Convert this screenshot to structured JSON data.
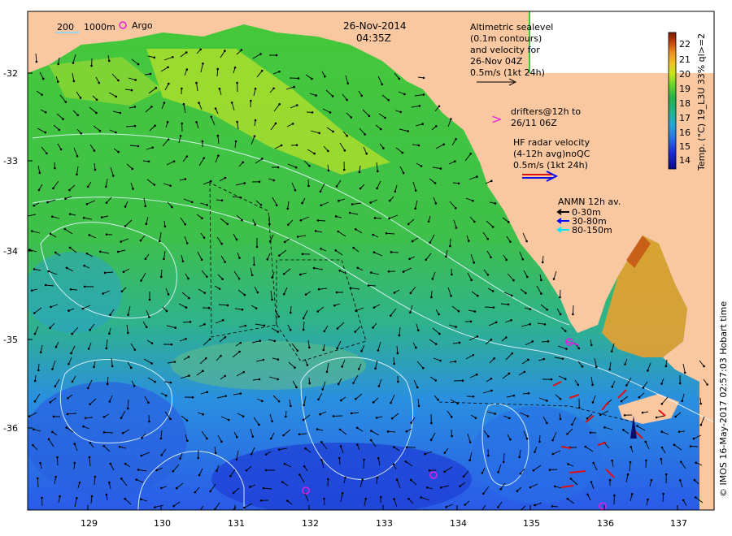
{
  "title": {
    "date": "26-Nov-2014",
    "time": "04:35Z"
  },
  "bathy_legend": {
    "depth1": "200",
    "depth2": "1000m",
    "argo_label": "Argo"
  },
  "altimetry_legend": {
    "lines": [
      "Altimetric sealevel",
      "(0.1m contours)",
      "and velocity for",
      "26-Nov 04Z",
      "0.5m/s (1kt 24h)"
    ]
  },
  "drifters_legend": {
    "symbol": ">",
    "lines": [
      "drifters@12h to",
      "26/11 06Z"
    ]
  },
  "hf_radar_legend": {
    "lines": [
      "HF radar velocity",
      "(4-12h avg)noQC",
      "0.5m/s (1kt 24h)"
    ]
  },
  "anmn_legend": {
    "title": "ANMN 12h av.",
    "items": [
      {
        "label": "0-30m",
        "color": "#000000"
      },
      {
        "label": "30-80m",
        "color": "#0000ff"
      },
      {
        "label": "80-150m",
        "color": "#00e5ff"
      }
    ]
  },
  "colorbar": {
    "title": "Temp. (°C) 19_L3U 33% ql>=2",
    "ticks": [
      "22",
      "21",
      "20",
      "19",
      "18",
      "17",
      "16",
      "15",
      "14"
    ],
    "colors": [
      "#7a1a00",
      "#c2410c",
      "#ea8a1f",
      "#f0c020",
      "#c8e61a",
      "#6ed42a",
      "#22b24a",
      "#1fb38a",
      "#23a6d6",
      "#2a6ee6",
      "#1a2bd6",
      "#0a0a8a"
    ]
  },
  "x_axis": {
    "ticks": [
      "129",
      "130",
      "131",
      "132",
      "133",
      "134",
      "135",
      "136",
      "137"
    ]
  },
  "y_axis": {
    "ticks": [
      "-32",
      "-33",
      "-34",
      "-35",
      "-36"
    ]
  },
  "credit": "© IMOS 16-May-2017 02:57:03 Hobart time",
  "colors": {
    "land": "#f9c8a0",
    "ocean_green": "#38c43c",
    "ocean_blue": "#2a5ae8",
    "shelf_yellow": "#c8e61a"
  }
}
